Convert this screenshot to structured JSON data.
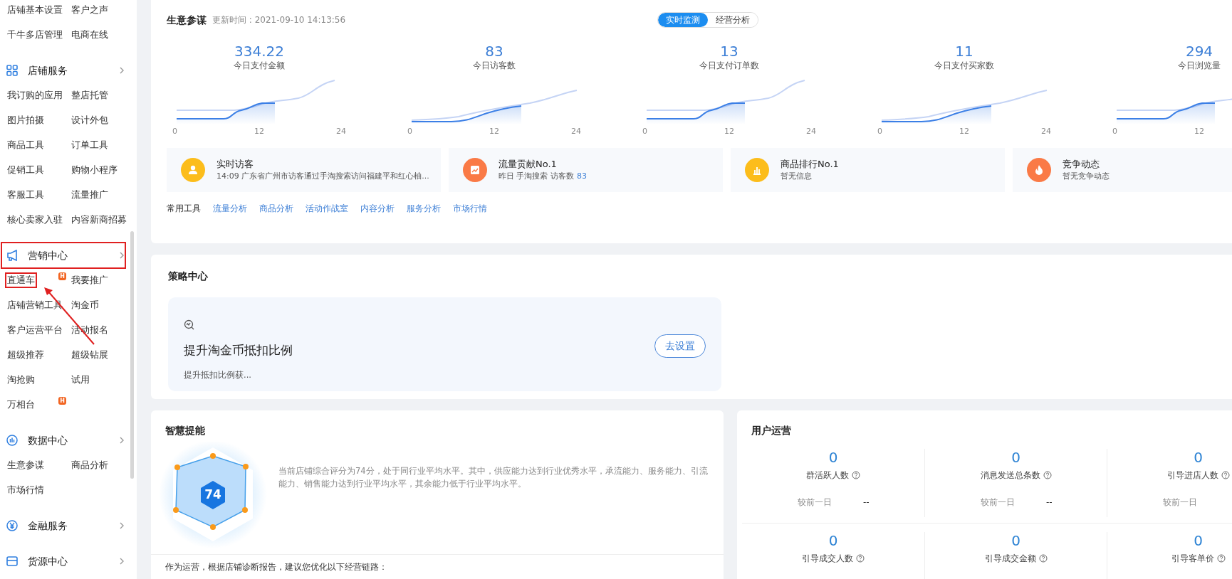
{
  "sidebar": {
    "sections": [
      {
        "items": [
          {
            "label": "店铺基本设置"
          },
          {
            "label": "客户之声"
          },
          {
            "label": "千牛多店管理"
          },
          {
            "label": "电商在线"
          }
        ]
      },
      {
        "title": "店铺服务",
        "items": [
          {
            "label": "我订购的应用"
          },
          {
            "label": "整店托管"
          },
          {
            "label": "图片拍摄"
          },
          {
            "label": "设计外包"
          },
          {
            "label": "商品工具"
          },
          {
            "label": "订单工具"
          },
          {
            "label": "促销工具"
          },
          {
            "label": "购物小程序"
          },
          {
            "label": "客服工具"
          },
          {
            "label": "流量推广"
          },
          {
            "label": "核心卖家入驻"
          },
          {
            "label": "内容新商招募"
          }
        ]
      },
      {
        "title": "营销中心",
        "highlighted": true,
        "items": [
          {
            "label": "直通车",
            "badge": "H",
            "highlighted": true
          },
          {
            "label": "我要推广"
          },
          {
            "label": "店铺营销工具"
          },
          {
            "label": "淘金币"
          },
          {
            "label": "客户运营平台"
          },
          {
            "label": "活动报名"
          },
          {
            "label": "超级推荐"
          },
          {
            "label": "超级钻展"
          },
          {
            "label": "淘抢购"
          },
          {
            "label": "试用"
          },
          {
            "label": "万相台",
            "badge": "H"
          }
        ]
      },
      {
        "title": "数据中心",
        "items": [
          {
            "label": "生意参谋"
          },
          {
            "label": "商品分析"
          },
          {
            "label": "市场行情"
          }
        ]
      },
      {
        "title": "金融服务"
      },
      {
        "title": "货源中心"
      }
    ],
    "annotation_arrow": true
  },
  "business_advisor": {
    "title": "生意参谋",
    "updated": "更新时间 : 2021-09-10 14:13:56",
    "view_tabs": [
      {
        "label": "实时监测",
        "selected": true
      },
      {
        "label": "经营分析",
        "selected": false
      }
    ],
    "metrics": [
      {
        "value": "334.22",
        "label": "今日支付金额",
        "ticks": [
          "0",
          "12",
          "24"
        ]
      },
      {
        "value": "83",
        "label": "今日访客数",
        "ticks": [
          "0",
          "12",
          "24"
        ]
      },
      {
        "value": "13",
        "label": "今日支付订单数",
        "ticks": [
          "0",
          "12",
          "24"
        ]
      },
      {
        "value": "11",
        "label": "今日支付买家数",
        "ticks": [
          "0",
          "12",
          "24"
        ]
      },
      {
        "value": "294",
        "label": "今日浏览量",
        "ticks": [
          "0",
          "12"
        ]
      }
    ],
    "insights": [
      {
        "kind": "person",
        "color": "#fcbd1b",
        "title": "实时访客",
        "text": "14:09 广东省广州市访客通过手淘搜索访问福建平和红心柚..."
      },
      {
        "kind": "trend",
        "color": "#fa7a46",
        "title": "流量贡献No.1",
        "text": "昨日 手淘搜索 访客数",
        "value": "83"
      },
      {
        "kind": "bars",
        "color": "#fcbd1b",
        "title": "商品排行No.1",
        "text": "暂无信息"
      },
      {
        "kind": "flame",
        "color": "#fa7a46",
        "title": "竞争动态",
        "text": "暂无竞争动态"
      }
    ],
    "tools_label": "常用工具",
    "tools": [
      "流量分析",
      "商品分析",
      "活动作战室",
      "内容分析",
      "服务分析",
      "市场行情"
    ]
  },
  "strategy": {
    "title": "策略中心",
    "task": {
      "title": "提升淘金币抵扣比例",
      "text": "提升抵扣比例获...",
      "button": "去设置"
    }
  },
  "smart_boost": {
    "title": "智慧提能",
    "score": "74",
    "summary": "当前店铺综合评分为74分，处于同行业平均水平。其中，供应能力达到行业优秀水平，承流能力、服务能力、引流能力、销售能力达到行业平均水平，其余能力低于行业平均水平。",
    "advice": "作为运营，根据店铺诊断报告，建议您优化以下经营链路："
  },
  "user_ops": {
    "title": "用户运营",
    "metrics": [
      {
        "value": "0",
        "label": "群活跃人数",
        "compare_label": "较前一日",
        "compare_value": "--"
      },
      {
        "value": "0",
        "label": "消息发送总条数",
        "compare_label": "较前一日",
        "compare_value": "--"
      },
      {
        "value": "0",
        "label": "引导进店人数",
        "compare_label": "较前一日"
      },
      {
        "value": "0",
        "label": "引导成交人数"
      },
      {
        "value": "0",
        "label": "引导成交金额"
      },
      {
        "value": "0",
        "label": "引导客单价"
      }
    ]
  }
}
